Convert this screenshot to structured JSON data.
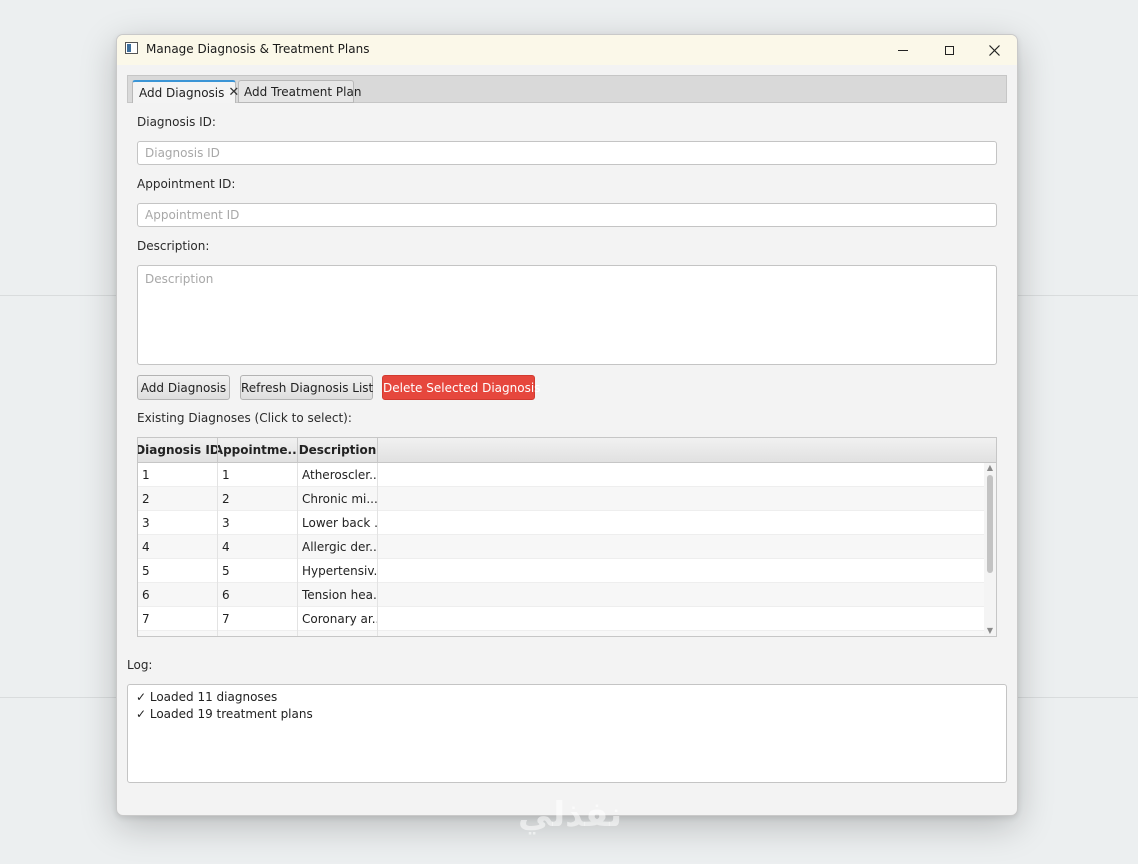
{
  "window": {
    "title": "Manage Diagnosis & Treatment Plans"
  },
  "tabs": [
    {
      "label": "Add Diagnosis",
      "active": true,
      "close_glyph": "✕"
    },
    {
      "label": "Add Treatment Plan",
      "active": false
    }
  ],
  "form": {
    "diagnosis_id_label": "Diagnosis ID:",
    "diagnosis_id_placeholder": "Diagnosis ID",
    "diagnosis_id_value": "",
    "appointment_id_label": "Appointment ID:",
    "appointment_id_placeholder": "Appointment ID",
    "appointment_id_value": "",
    "description_label": "Description:",
    "description_placeholder": "Description",
    "description_value": ""
  },
  "buttons": {
    "add": "Add Diagnosis",
    "refresh": "Refresh Diagnosis List",
    "delete": "Delete Selected Diagnosis"
  },
  "table": {
    "caption": "Existing Diagnoses (Click to select):",
    "columns": [
      "Diagnosis ID",
      "Appointme...",
      "Description"
    ],
    "rows": [
      {
        "diagnosis_id": "1",
        "appointment_id": "1",
        "description": "Atheroscler..."
      },
      {
        "diagnosis_id": "2",
        "appointment_id": "2",
        "description": "Chronic mi..."
      },
      {
        "diagnosis_id": "3",
        "appointment_id": "3",
        "description": "Lower back ..."
      },
      {
        "diagnosis_id": "4",
        "appointment_id": "4",
        "description": "Allergic der..."
      },
      {
        "diagnosis_id": "5",
        "appointment_id": "5",
        "description": "Hypertensiv..."
      },
      {
        "diagnosis_id": "6",
        "appointment_id": "6",
        "description": "Tension hea..."
      },
      {
        "diagnosis_id": "7",
        "appointment_id": "7",
        "description": "Coronary ar..."
      }
    ]
  },
  "log": {
    "label": "Log:",
    "lines": [
      "✓ Loaded 11 diagnoses",
      "✓ Loaded 19 treatment plans"
    ]
  },
  "watermark": "نفذلي",
  "colors": {
    "titlebar": "#fbf8e9",
    "tab_accent": "#3b95d6",
    "danger_button": "#e6473d"
  }
}
